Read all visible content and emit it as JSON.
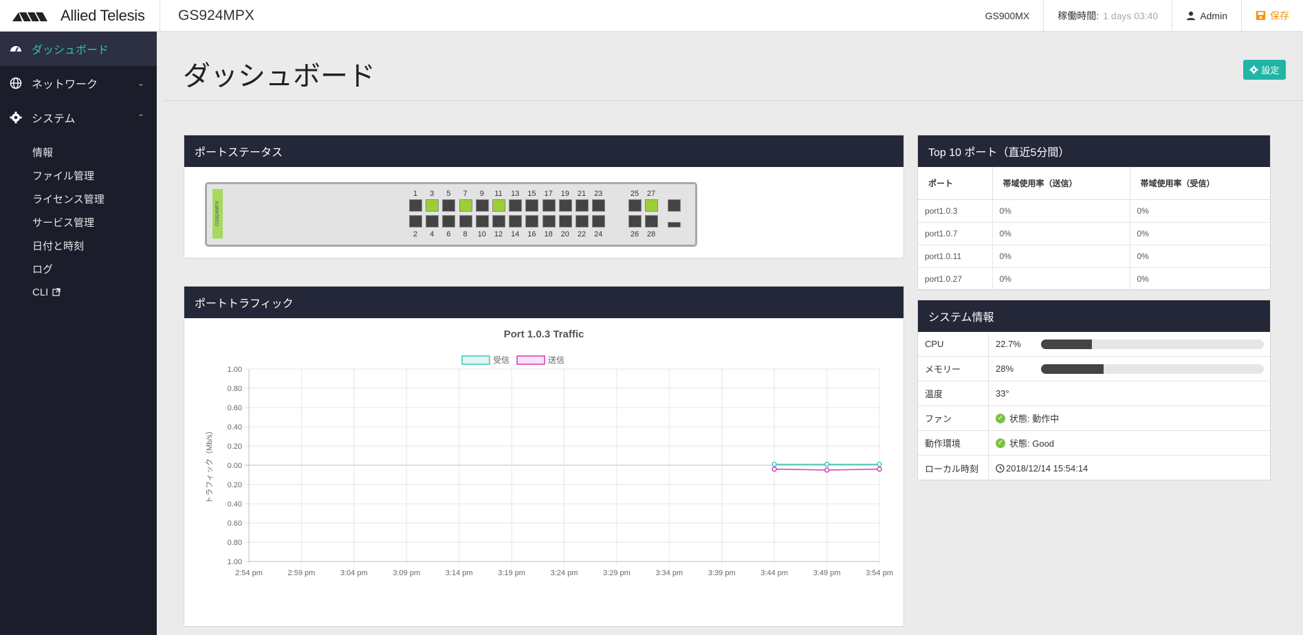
{
  "header": {
    "brand": "Allied Telesis",
    "model": "GS924MPX",
    "series": "GS900MX",
    "uptime_label": "稼働時間:",
    "uptime_value": "1 days 03:40",
    "user": "Admin",
    "save": "保存"
  },
  "sidebar": {
    "items": [
      {
        "label": "ダッシュボード",
        "icon": "dashboard-icon",
        "active": true
      },
      {
        "label": "ネットワーク",
        "icon": "globe-icon",
        "caret": "chevron-down"
      },
      {
        "label": "システム",
        "icon": "gear-icon",
        "caret": "chevron-up"
      }
    ],
    "subitems": [
      "情報",
      "ファイル管理",
      "ライセンス管理",
      "サービス管理",
      "日付と時刻",
      "ログ",
      "CLI"
    ]
  },
  "page": {
    "title": "ダッシュボード",
    "settings_button": "設定"
  },
  "port_status": {
    "title": "ポートステータス",
    "device_label": "GS924MPX",
    "top_numbers": [
      "1",
      "3",
      "5",
      "7",
      "9",
      "11",
      "13",
      "15",
      "17",
      "19",
      "21",
      "23",
      "25",
      "27"
    ],
    "bottom_numbers": [
      "2",
      "4",
      "6",
      "8",
      "10",
      "12",
      "14",
      "16",
      "18",
      "20",
      "22",
      "24",
      "26",
      "28"
    ],
    "top_up": [
      false,
      true,
      false,
      true,
      false,
      true,
      false,
      false,
      false,
      false,
      false,
      false,
      false,
      true
    ],
    "bottom_up": [
      false,
      false,
      false,
      false,
      false,
      false,
      false,
      false,
      false,
      false,
      false,
      false,
      false,
      false
    ]
  },
  "top10": {
    "title": "Top 10 ポート（直近5分間）",
    "columns": [
      "ポート",
      "帯域使用率（送信）",
      "帯域使用率（受信）"
    ],
    "rows": [
      [
        "port1.0.3",
        "0%",
        "0%"
      ],
      [
        "port1.0.7",
        "0%",
        "0%"
      ],
      [
        "port1.0.11",
        "0%",
        "0%"
      ],
      [
        "port1.0.27",
        "0%",
        "0%"
      ]
    ]
  },
  "system_info": {
    "title": "システム情報",
    "cpu_label": "CPU",
    "cpu_value": "22.7%",
    "cpu_fraction": 0.227,
    "mem_label": "メモリー",
    "mem_value": "28%",
    "mem_fraction": 0.28,
    "temp_label": "温度",
    "temp_value": "33°",
    "fan_label": "ファン",
    "fan_value": "状態: 動作中",
    "env_label": "動作環境",
    "env_value": "状態: Good",
    "time_label": "ローカル時刻",
    "time_value": "2018/12/14 15:54:14"
  },
  "traffic": {
    "title": "ポートトラフィック"
  },
  "chart_data": {
    "type": "line",
    "title": "Port 1.0.3 Traffic",
    "ylabel": "トラフィック（Mb/s）",
    "x_ticks": [
      "2:54 pm",
      "2:59 pm",
      "3:04 pm",
      "3:09 pm",
      "3:14 pm",
      "3:19 pm",
      "3:24 pm",
      "3:29 pm",
      "3:34 pm",
      "3:39 pm",
      "3:44 pm",
      "3:49 pm",
      "3:54 pm"
    ],
    "y_ticks": [
      "1.00",
      "0.80",
      "0.60",
      "0.40",
      "0.20",
      "0.00",
      "0.20",
      "0.40",
      "0.60",
      "0.80",
      "1.00"
    ],
    "ylim": [
      -1,
      1
    ],
    "series": [
      {
        "name": "受信",
        "color": "#3cc8b8",
        "x": [
          "3:44 pm",
          "3:49 pm",
          "3:54 pm"
        ],
        "values": [
          0.01,
          0.01,
          0.01
        ]
      },
      {
        "name": "送信",
        "color": "#d63ab5",
        "x": [
          "3:44 pm",
          "3:49 pm",
          "3:54 pm"
        ],
        "values": [
          -0.04,
          -0.05,
          -0.04
        ]
      }
    ],
    "legend": "top"
  }
}
